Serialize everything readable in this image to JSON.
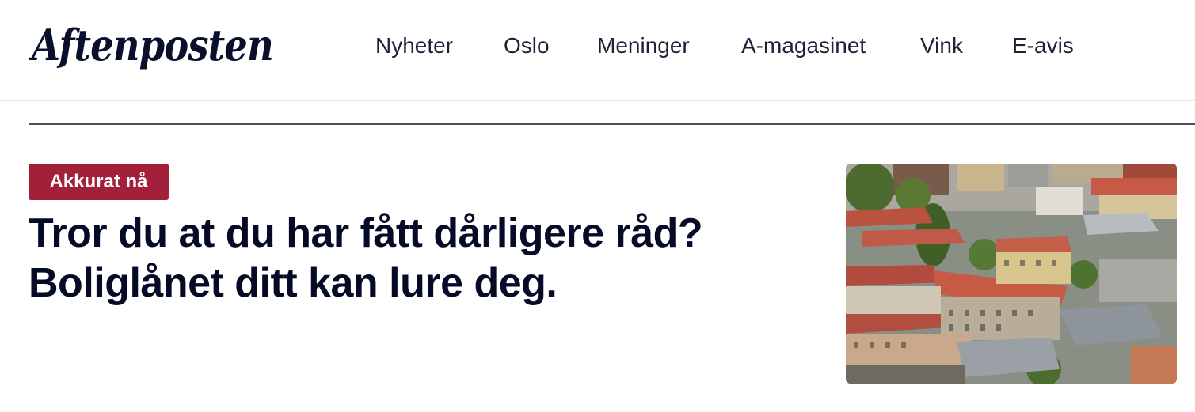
{
  "header": {
    "logo_text": "Aftenposten",
    "nav": [
      {
        "label": "Nyheter"
      },
      {
        "label": "Oslo"
      },
      {
        "label": "Meninger"
      },
      {
        "label": "A-magasinet"
      },
      {
        "label": "Vink"
      },
      {
        "label": "E-avis"
      }
    ]
  },
  "article": {
    "badge": "Akkurat nå",
    "headline_line1": "Tror du at du har fått dårligere råd?",
    "headline_line2": "Boliglånet ditt kan lure deg.",
    "image_icon": "city-rooftops-photo"
  },
  "colors": {
    "badge_bg": "#a3203a",
    "text": "#0a0f2c"
  }
}
